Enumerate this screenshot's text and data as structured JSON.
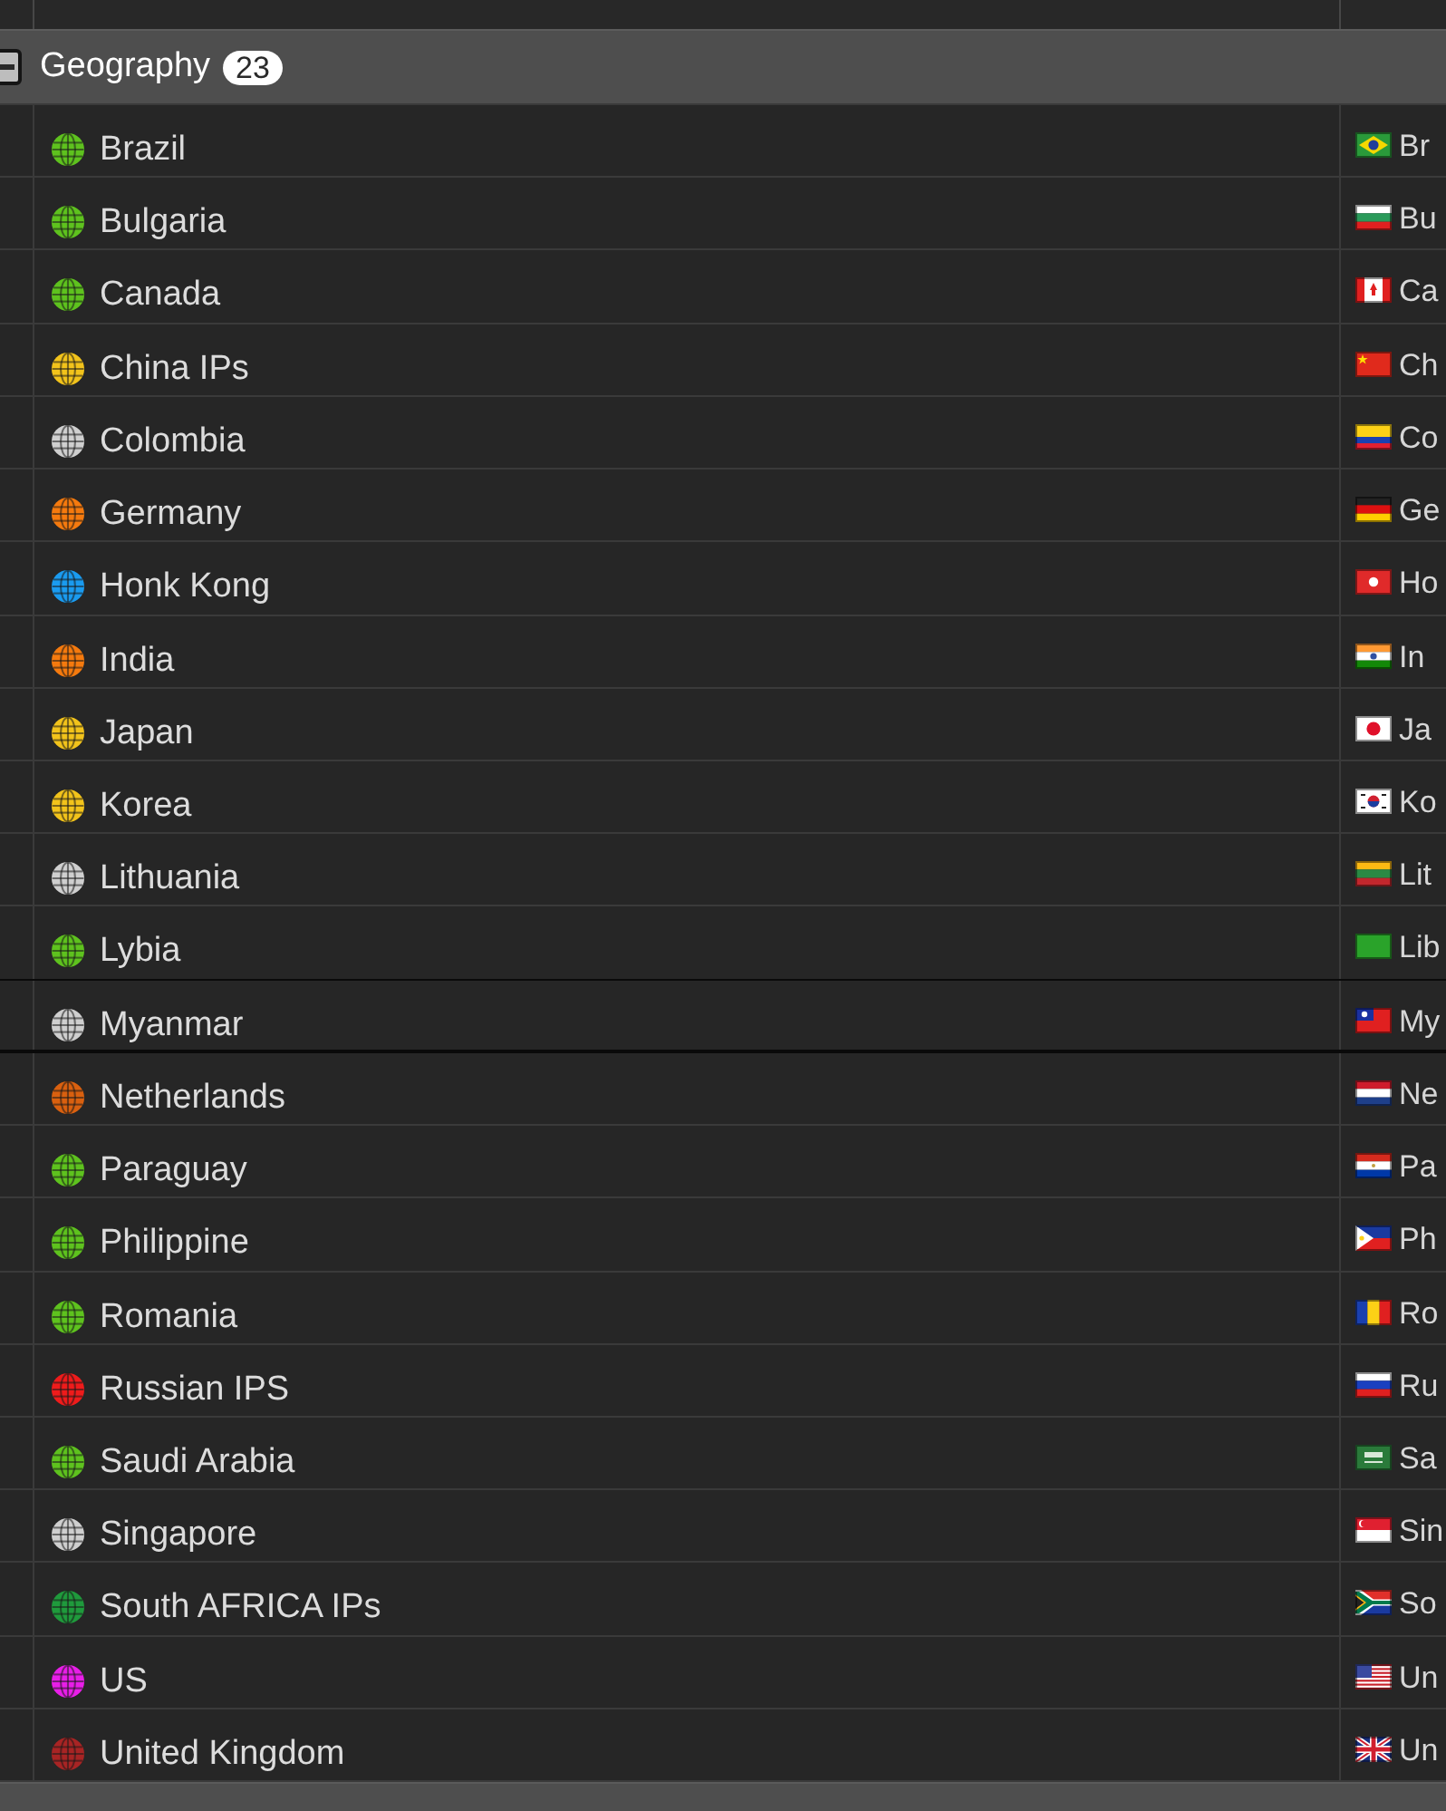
{
  "table": {
    "group": {
      "label": "Geography",
      "count": "23",
      "expanded": true
    },
    "rows": [
      {
        "name": "Brazil",
        "color": "#5ec21e",
        "flag": {
          "kind": "brazil"
        },
        "country": "Br",
        "selected": false
      },
      {
        "name": "Bulgaria",
        "color": "#5ec21e",
        "flag": {
          "kind": "bulgaria"
        },
        "country": "Bu",
        "selected": false
      },
      {
        "name": "Canada",
        "color": "#5ec21e",
        "flag": {
          "kind": "canada"
        },
        "country": "Ca",
        "selected": false
      },
      {
        "name": "China IPs",
        "color": "#f2c31b",
        "flag": {
          "kind": "china"
        },
        "country": "Ch",
        "selected": false
      },
      {
        "name": "Colombia",
        "color": "#cfcfcf",
        "flag": {
          "kind": "colombia"
        },
        "country": "Co",
        "selected": false
      },
      {
        "name": "Germany",
        "color": "#f57a0e",
        "flag": {
          "kind": "germany"
        },
        "country": "Ge",
        "selected": false
      },
      {
        "name": "Honk Kong",
        "color": "#1a9bf0",
        "flag": {
          "kind": "hongkong"
        },
        "country": "Ho",
        "selected": false
      },
      {
        "name": "India",
        "color": "#f57a0e",
        "flag": {
          "kind": "india"
        },
        "country": "In",
        "selected": false
      },
      {
        "name": "Japan",
        "color": "#f2c31b",
        "flag": {
          "kind": "japan"
        },
        "country": "Ja",
        "selected": false
      },
      {
        "name": "Korea",
        "color": "#f2c31b",
        "flag": {
          "kind": "korea"
        },
        "country": "Ko",
        "selected": false
      },
      {
        "name": "Lithuania",
        "color": "#cfcfcf",
        "flag": {
          "kind": "lithuania"
        },
        "country": "Lit",
        "selected": false
      },
      {
        "name": "Lybia",
        "color": "#5ec21e",
        "flag": {
          "kind": "libya"
        },
        "country": "Lib",
        "selected": false
      },
      {
        "name": "Myanmar",
        "color": "#cfcfcf",
        "flag": {
          "kind": "myanmar"
        },
        "country": "My",
        "selected": true
      },
      {
        "name": "Netherlands",
        "color": "#d9600f",
        "flag": {
          "kind": "netherlands"
        },
        "country": "Ne",
        "selected": false
      },
      {
        "name": "Paraguay",
        "color": "#5ec21e",
        "flag": {
          "kind": "paraguay"
        },
        "country": "Pa",
        "selected": false
      },
      {
        "name": "Philippine",
        "color": "#5ec21e",
        "flag": {
          "kind": "philippines"
        },
        "country": "Ph",
        "selected": false
      },
      {
        "name": "Romania",
        "color": "#5ec21e",
        "flag": {
          "kind": "romania"
        },
        "country": "Ro",
        "selected": false
      },
      {
        "name": "Russian IPS",
        "color": "#ef1b1b",
        "flag": {
          "kind": "russia"
        },
        "country": "Ru",
        "selected": false
      },
      {
        "name": "Saudi Arabia",
        "color": "#5ec21e",
        "flag": {
          "kind": "saudi"
        },
        "country": "Sa",
        "selected": false
      },
      {
        "name": "Singapore",
        "color": "#cfcfcf",
        "flag": {
          "kind": "singapore"
        },
        "country": "Sin",
        "selected": false
      },
      {
        "name": "South AFRICA IPs",
        "color": "#1f9a3c",
        "flag": {
          "kind": "southafrica"
        },
        "country": "So",
        "selected": false
      },
      {
        "name": "US",
        "color": "#e81ee8",
        "flag": {
          "kind": "us"
        },
        "country": "Un",
        "selected": false
      },
      {
        "name": "United Kingdom",
        "color": "#a82424",
        "flag": {
          "kind": "uk"
        },
        "country": "Un",
        "selected": false
      }
    ]
  }
}
